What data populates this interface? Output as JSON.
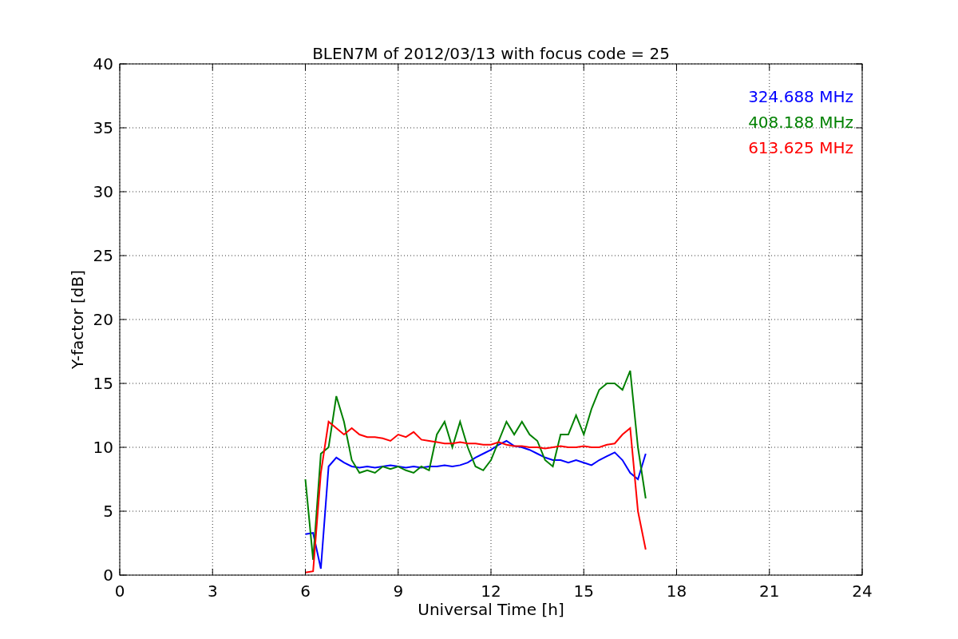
{
  "figure": {
    "chart_data": {
      "type": "line",
      "title": "BLEN7M of 2012/03/13 with focus code = 25",
      "xlabel": "Universal Time [h]",
      "ylabel": "Y-factor [dB]",
      "x": [
        6,
        6.25,
        6.5,
        6.75,
        7,
        7.25,
        7.5,
        7.75,
        8,
        8.25,
        8.5,
        8.75,
        9,
        9.25,
        9.5,
        9.75,
        10,
        10.25,
        10.5,
        10.75,
        11,
        11.25,
        11.5,
        11.75,
        12,
        12.25,
        12.5,
        12.75,
        13,
        13.25,
        13.5,
        13.75,
        14,
        14.25,
        14.5,
        14.75,
        15,
        15.25,
        15.5,
        15.75,
        16,
        16.25,
        16.5,
        16.75,
        17
      ],
      "series": [
        {
          "name": "324.688 MHz",
          "color": "#0000ff",
          "values": [
            3.2,
            3.3,
            0.5,
            8.5,
            9.2,
            8.8,
            8.5,
            8.4,
            8.5,
            8.4,
            8.5,
            8.6,
            8.5,
            8.4,
            8.5,
            8.4,
            8.5,
            8.5,
            8.6,
            8.5,
            8.6,
            8.8,
            9.2,
            9.5,
            9.8,
            10.2,
            10.5,
            10.1,
            10,
            9.8,
            9.5,
            9.2,
            9,
            9,
            8.8,
            9,
            8.8,
            8.6,
            9,
            9.3,
            9.6,
            9,
            8,
            7.5,
            9.5
          ]
        },
        {
          "name": "408.188 MHz",
          "color": "#008000",
          "values": [
            7.5,
            1.2,
            9.5,
            10,
            14,
            12,
            9,
            8,
            8.2,
            8,
            8.5,
            8.3,
            8.5,
            8.2,
            8,
            8.5,
            8.2,
            11,
            12,
            10,
            12,
            10,
            8.5,
            8.2,
            9,
            10.5,
            12,
            11,
            12,
            11,
            10.5,
            9,
            8.5,
            11,
            11,
            12.5,
            11,
            13,
            14.5,
            15,
            15,
            14.5,
            16,
            10,
            6
          ]
        },
        {
          "name": "613.625 MHz",
          "color": "#ff0000",
          "values": [
            0.2,
            0.3,
            8,
            12,
            11.5,
            11,
            11.5,
            11,
            10.8,
            10.8,
            10.7,
            10.5,
            11,
            10.8,
            11.2,
            10.6,
            10.5,
            10.4,
            10.3,
            10.3,
            10.4,
            10.3,
            10.3,
            10.2,
            10.2,
            10.4,
            10.2,
            10.1,
            10.1,
            10,
            10,
            9.9,
            10,
            10.1,
            10,
            10,
            10.1,
            10,
            10,
            10.2,
            10.3,
            11,
            11.5,
            5,
            2
          ]
        }
      ],
      "xlim": [
        0,
        24
      ],
      "ylim": [
        0,
        40
      ],
      "xticks": [
        0,
        3,
        6,
        9,
        12,
        15,
        18,
        21,
        24
      ],
      "yticks": [
        0,
        5,
        10,
        15,
        20,
        25,
        30,
        35,
        40
      ],
      "grid": true
    }
  }
}
